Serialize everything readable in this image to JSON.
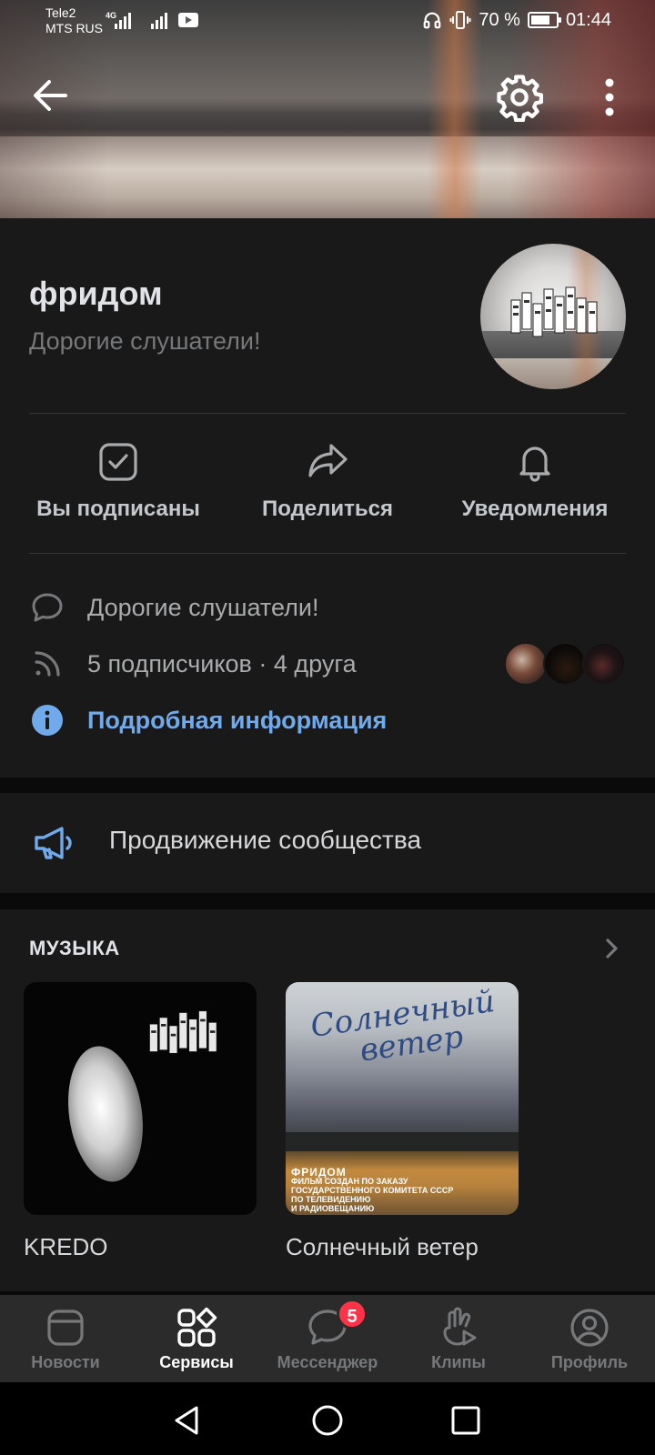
{
  "status_bar": {
    "carrier_1": "Tele2",
    "carrier_2": "MTS RUS",
    "network": "4G",
    "battery": "70 %",
    "time": "01:44"
  },
  "header": {
    "back_icon": "arrow-left-icon",
    "settings_icon": "gear-icon",
    "more_icon": "more-vertical-icon"
  },
  "group": {
    "name": "фридом",
    "status": "Дорогие слушатели!"
  },
  "actions": [
    {
      "label": "Вы подписаны",
      "icon": "checkbox-icon"
    },
    {
      "label": "Поделиться",
      "icon": "share-icon"
    },
    {
      "label": "Уведомления",
      "icon": "bell-icon"
    }
  ],
  "info": {
    "status_text": "Дорогие слушатели!",
    "subscribers_text": "5 подписчиков · 4 друга",
    "details_link": "Подробная информация"
  },
  "promo": {
    "label": "Продвижение сообщества"
  },
  "music": {
    "section_title": "МУЗЫКА",
    "albums": [
      {
        "title": "KREDO"
      },
      {
        "title": "Солнечный ветер",
        "cover_script_line1": "Солнечный",
        "cover_script_line2": "ветер",
        "cover_band": "ФРИДОМ",
        "cover_caption": [
          "ФИЛЬМ СОЗДАН ПО ЗАКАЗУ",
          "ГОСУДАРСТВЕННОГО КОМИТЕТА СССР",
          "ПО ТЕЛЕВИДЕНИЮ",
          "И РАДИОВЕЩАНИЮ"
        ]
      }
    ]
  },
  "tabs": [
    {
      "label": "Новости",
      "icon": "news-icon",
      "active": false
    },
    {
      "label": "Сервисы",
      "icon": "services-icon",
      "active": true
    },
    {
      "label": "Мессенджер",
      "icon": "messenger-icon",
      "active": false,
      "badge": "5"
    },
    {
      "label": "Клипы",
      "icon": "clips-icon",
      "active": false
    },
    {
      "label": "Профиль",
      "icon": "profile-icon",
      "active": false
    }
  ],
  "colors": {
    "background": "#0a0a0a",
    "card": "#19191a",
    "accent_link": "#71aaeb",
    "badge": "#ff3347",
    "tabbar": "#2b2b2c"
  }
}
